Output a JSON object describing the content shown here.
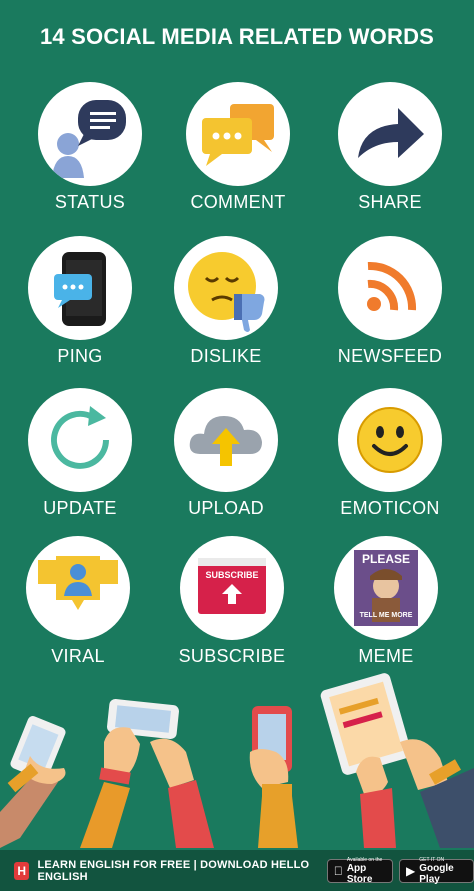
{
  "title": "14 SOCIAL MEDIA RELATED WORDS",
  "items": [
    {
      "label": "STATUS",
      "icon": "status-chat-person-icon"
    },
    {
      "label": "COMMENT",
      "icon": "comment-bubbles-icon"
    },
    {
      "label": "SHARE",
      "icon": "share-arrow-icon"
    },
    {
      "label": "PING",
      "icon": "ping-phone-icon"
    },
    {
      "label": "DISLIKE",
      "icon": "dislike-emoji-icon"
    },
    {
      "label": "NEWSFEED",
      "icon": "rss-feed-icon"
    },
    {
      "label": "UPDATE",
      "icon": "refresh-icon"
    },
    {
      "label": "UPLOAD",
      "icon": "cloud-upload-icon"
    },
    {
      "label": "EMOTICON",
      "icon": "smiley-icon"
    },
    {
      "label": "VIRAL",
      "icon": "viral-people-icon"
    },
    {
      "label": "SUBSCRIBE",
      "icon": "subscribe-button-icon"
    },
    {
      "label": "MEME",
      "icon": "meme-image-icon"
    }
  ],
  "subscribe_text": "SUBSCRIBE",
  "meme": {
    "top": "PLEASE",
    "bottom": "TELL ME MORE"
  },
  "footer": {
    "logo": "H",
    "text": "LEARN ENGLISH FOR FREE | DOWNLOAD HELLO ENGLISH",
    "app_store": {
      "small": "Available on the",
      "big": "App Store"
    },
    "google_play": {
      "small": "GET IT ON",
      "big": "Google Play"
    }
  },
  "colors": {
    "background": "#1a7a5e",
    "footer": "#12543f",
    "accent": "#f5c400"
  }
}
